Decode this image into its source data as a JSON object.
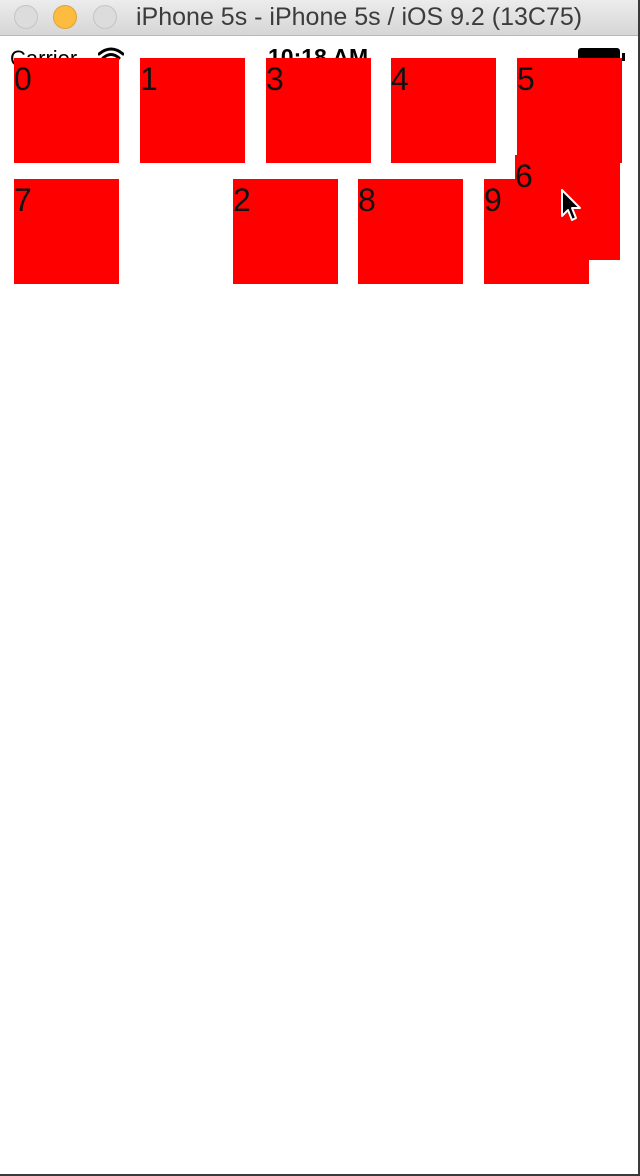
{
  "window": {
    "title": "iPhone 5s - iPhone 5s / iOS 9.2 (13C75)"
  },
  "statusbar": {
    "carrier": "Carrier",
    "time": "10:18 AM"
  },
  "tiles": [
    {
      "label": "0"
    },
    {
      "label": "1"
    },
    {
      "label": "3"
    },
    {
      "label": "4"
    },
    {
      "label": "5"
    },
    {
      "label": "7"
    },
    {
      "label": "2"
    },
    {
      "label": "8"
    },
    {
      "label": "9"
    },
    {
      "label": "6"
    }
  ],
  "colors": {
    "tile": "#ff0000",
    "minimize": "#fdbc40"
  },
  "icons": [
    "close-icon",
    "minimize-icon",
    "zoom-icon",
    "wifi-icon",
    "battery-icon",
    "cursor-icon"
  ]
}
